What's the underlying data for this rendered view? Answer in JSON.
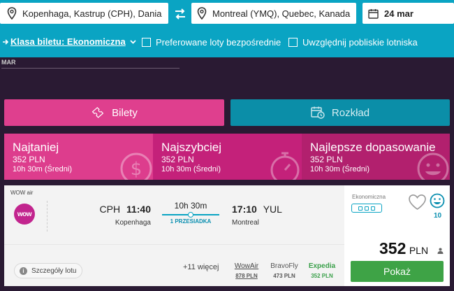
{
  "search": {
    "from": "Kopenhaga, Kastrup (CPH), Dania",
    "to": "Montreal (YMQ), Quebec, Kanada",
    "date": "24 mar"
  },
  "options": {
    "cabin_label": "Klasa biletu: Ekonomiczna",
    "direct_label": "Preferowane loty bezpośrednie",
    "nearby_label": "Uwzględnij pobliskie lotniska"
  },
  "month": "MAR",
  "tabs": [
    {
      "label": "Bilety"
    },
    {
      "label": "Rozkład"
    }
  ],
  "sorts": [
    {
      "title": "Najtaniej",
      "price": "352 PLN",
      "duration": "10h 30m (Średni)"
    },
    {
      "title": "Najszybciej",
      "price": "352 PLN",
      "duration": "10h 30m (Średni)"
    },
    {
      "title": "Najlepsze dopasowanie",
      "price": "352 PLN",
      "duration": "10h 30m (Średni)"
    }
  ],
  "result": {
    "airline": "WOW air",
    "logo_text": "wow",
    "dep_code": "CPH",
    "dep_time": "11:40",
    "dep_city": "Kopenhaga",
    "duration": "10h 30m",
    "stops": "1 PRZESIADKA",
    "arr_time": "17:10",
    "arr_code": "YUL",
    "arr_city": "Montreal",
    "details_label": "Szczegóły lotu",
    "more_label": "+11 więcej",
    "providers": [
      {
        "name": "WowAir",
        "price": "878 PLN"
      },
      {
        "name": "BravoFly",
        "price": "473 PLN"
      },
      {
        "name": "Expedia",
        "price": "352 PLN"
      }
    ],
    "cabin": "Ekonomiczna",
    "score": "10",
    "price_amount": "352",
    "price_currency": "PLN",
    "show_label": "Pokaż"
  },
  "colors": {
    "topbar": "#0aa4c3",
    "tickets_tab": "#df3f8e",
    "schedule_tab": "#0b8ea8",
    "show_button": "#3ea346"
  }
}
